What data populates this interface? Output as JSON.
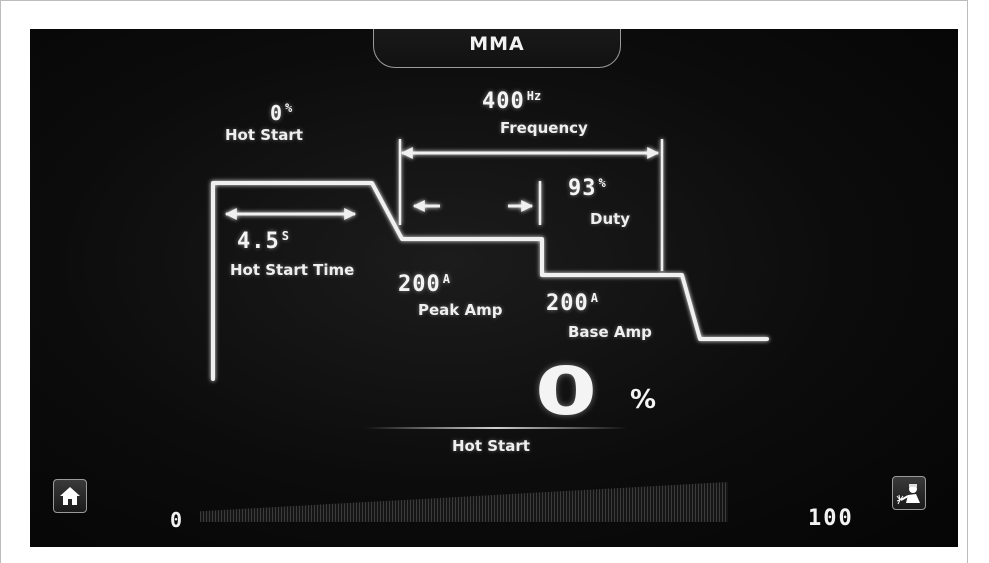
{
  "mode": {
    "title": "MMA"
  },
  "hot_start": {
    "value": "0",
    "unit": "%",
    "label": "Hot Start"
  },
  "frequency": {
    "value": "400",
    "unit": "Hz",
    "label": "Frequency"
  },
  "duty": {
    "value": "93",
    "unit": "%",
    "label": "Duty"
  },
  "hot_start_time": {
    "value": "4.5",
    "unit": "S",
    "label": "Hot Start Time"
  },
  "peak_amp": {
    "value": "200",
    "unit": "A",
    "label": "Peak Amp"
  },
  "base_amp": {
    "value": "200",
    "unit": "A",
    "label": "Base Amp"
  },
  "selected": {
    "value": "0",
    "unit": "%",
    "label": "Hot Start"
  },
  "slider": {
    "min": "0",
    "max": "100",
    "level": 0
  },
  "icons": {
    "home": "home-icon",
    "welder": "welder-icon"
  },
  "colors": {
    "screen_bg": "#0c0c0c",
    "line": "#f0f0f0"
  }
}
